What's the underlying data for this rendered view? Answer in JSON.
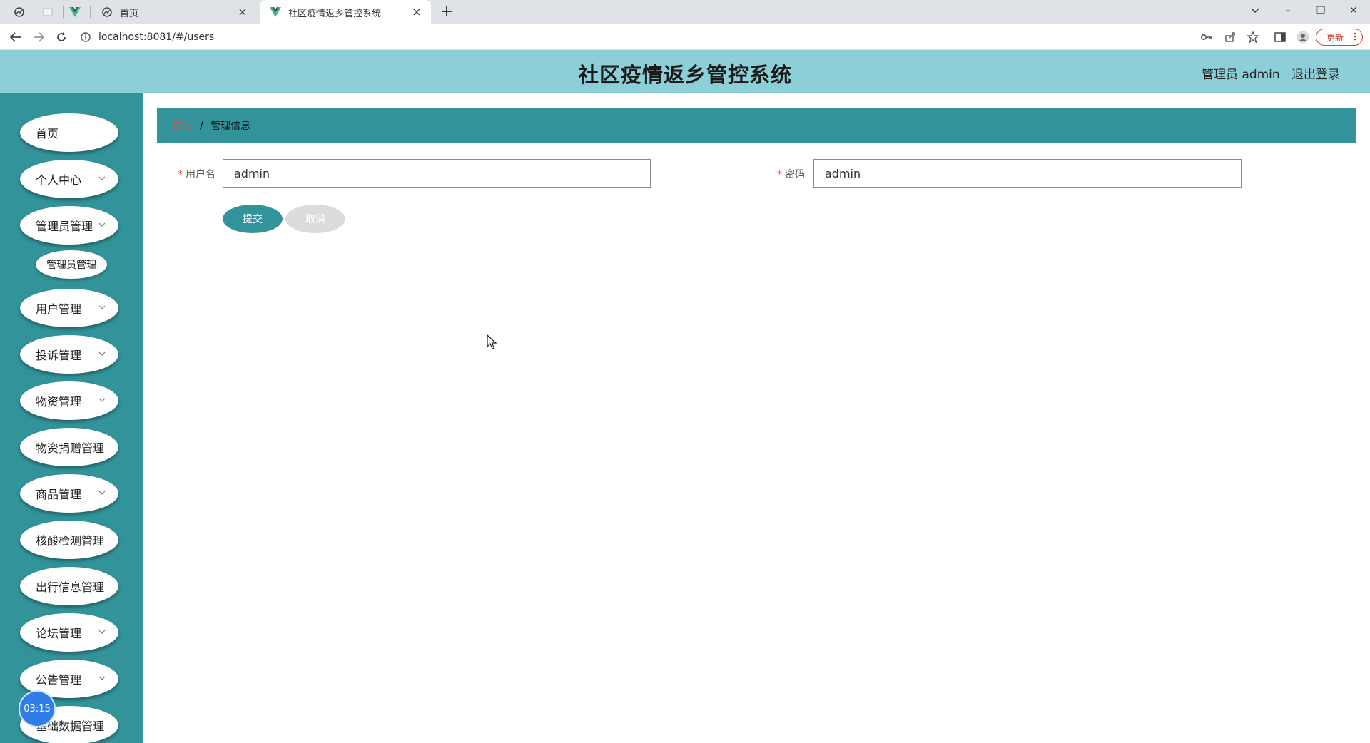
{
  "browser": {
    "tabs": [
      {
        "title": "首页",
        "close": "×"
      },
      {
        "title": "社区疫情返乡管控系统",
        "close": "×"
      }
    ],
    "new_tab": "+",
    "url": "localhost:8081/#/users",
    "update_label": "更新",
    "window": {
      "minimize": "–",
      "restore": "❐",
      "close": "✕",
      "chevron": "⌄"
    }
  },
  "app": {
    "title": "社区疫情返乡管控系统",
    "admin_label": "管理员 admin",
    "logout": "退出登录"
  },
  "sidebar": {
    "items": [
      {
        "label": "首页",
        "expandable": false
      },
      {
        "label": "个人中心",
        "expandable": true
      },
      {
        "label": "管理员管理",
        "expandable": true
      },
      {
        "label": "用户管理",
        "expandable": true
      },
      {
        "label": "投诉管理",
        "expandable": true
      },
      {
        "label": "物资管理",
        "expandable": true
      },
      {
        "label": "物资捐赠管理",
        "expandable": false
      },
      {
        "label": "商品管理",
        "expandable": true
      },
      {
        "label": "核酸检测管理",
        "expandable": false
      },
      {
        "label": "出行信息管理",
        "expandable": false
      },
      {
        "label": "论坛管理",
        "expandable": true
      },
      {
        "label": "公告管理",
        "expandable": true
      },
      {
        "label": "基础数据管理",
        "expandable": false
      }
    ],
    "submenu": {
      "label": "管理员管理"
    },
    "timer": "03:15"
  },
  "breadcrumb": {
    "home": "首页",
    "separator": "/",
    "current": "管理信息"
  },
  "form": {
    "username": {
      "label": "用户名",
      "value": "admin",
      "required": "*"
    },
    "password": {
      "label": "密码",
      "value": "admin",
      "required": "*"
    },
    "submit": "提交",
    "cancel": "取消"
  },
  "colors": {
    "header_bg": "#8dcfd8",
    "sidebar_bg": "#32939a",
    "accent": "#32939a",
    "breadcrumb_home": "#c9575a",
    "timer": "#2f7ee8"
  }
}
